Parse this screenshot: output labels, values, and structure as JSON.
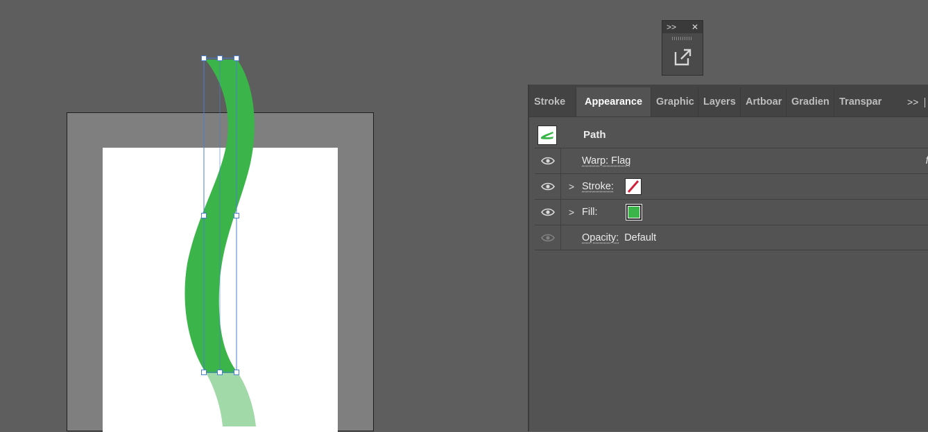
{
  "colors": {
    "path_fill": "#3bb54a",
    "path_fill_ghost": "#a1d9a8",
    "selection": "#4a7fd1",
    "stroke_none_red": "#d0203a"
  },
  "mini_panel": {
    "expand_icon": ">>",
    "close_icon": "✕",
    "export_icon": "export-icon"
  },
  "tabs": [
    {
      "label": "Stroke"
    },
    {
      "label": "Appearance"
    },
    {
      "label": "Graphic"
    },
    {
      "label": "Layers"
    },
    {
      "label": "Artboar"
    },
    {
      "label": "Gradien"
    },
    {
      "label": "Transpar"
    }
  ],
  "tabs_more": ">>",
  "appearance": {
    "title": "Path",
    "warp_label": "Warp: Flag",
    "fx_icon": "fx",
    "stroke_label": "Stroke:",
    "fill_label": "Fill:",
    "opacity_label": "Opacity:",
    "opacity_value": "Default",
    "twist": ">"
  }
}
